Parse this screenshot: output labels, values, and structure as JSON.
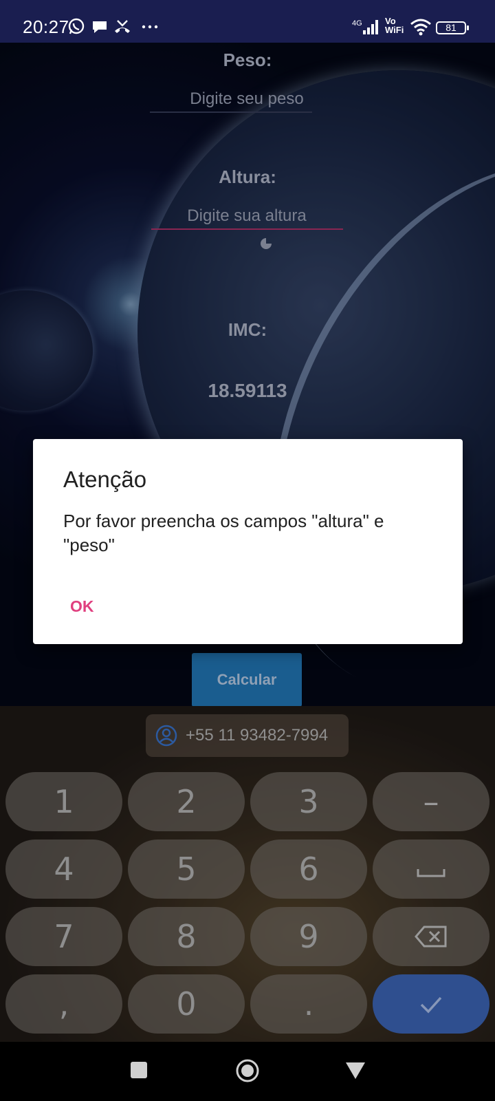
{
  "status_bar": {
    "time": "20:27",
    "icons": [
      "whatsapp-icon",
      "chat-icon",
      "missed-call-icon",
      "more-dots-icon"
    ],
    "network": "4G",
    "vowifi": "Vo\nWiFi",
    "battery": "81"
  },
  "form": {
    "weight_label": "Peso:",
    "weight_placeholder": "Digite seu peso",
    "height_label": "Altura:",
    "height_placeholder": "Digite sua altura",
    "imc_label": "IMC:",
    "imc_value": "18.59113",
    "calculate_button": "Calcular"
  },
  "dialog": {
    "title": "Atenção",
    "message": "Por favor preencha os campos \"altura\" e \"peso\"",
    "ok_button": "OK"
  },
  "keyboard": {
    "suggestion": "+55 11 93482-7994",
    "keys": [
      "1",
      "2",
      "3",
      "4",
      "5",
      "6",
      "7",
      "8",
      "9",
      ",",
      "0",
      "."
    ],
    "fn_keys": [
      "minus-key",
      "space-key",
      "backspace-key",
      "done-key"
    ],
    "minus_label": "–"
  },
  "colors": {
    "accent": "#e0407f",
    "status_bar_bg": "#1a1e50",
    "button_bg": "#1a5d8f",
    "done_key_bg": "#2f4f8f"
  }
}
